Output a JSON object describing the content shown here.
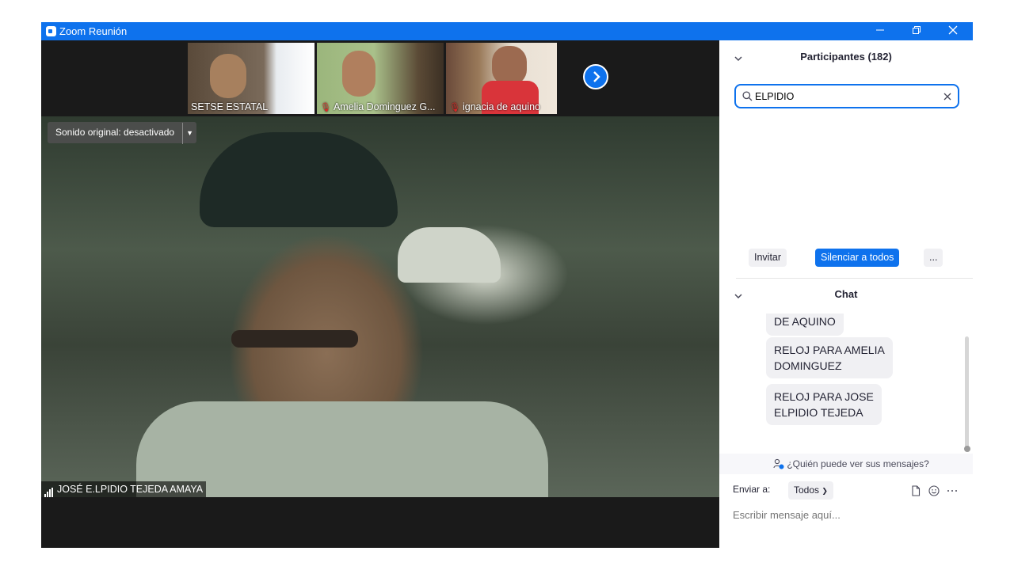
{
  "window": {
    "title": "Zoom Reunión"
  },
  "thumbnails": [
    {
      "name": "SETSE ESTATAL",
      "muted": false
    },
    {
      "name": "Amelia Dominguez G...",
      "muted": true
    },
    {
      "name": "ignacia de aquino",
      "muted": true
    }
  ],
  "main_video": {
    "sound_label": "Sonido original: desactivado",
    "speaker_name": "JOSÉ E.LPIDIO TEJEDA AMAYA"
  },
  "participants": {
    "title": "Participantes (182)",
    "search_value": "ELPIDIO",
    "invite_label": "Invitar",
    "mute_all_label": "Silenciar a todos",
    "more_label": "..."
  },
  "chat": {
    "title": "Chat",
    "messages": [
      {
        "line1": "DE AQUINO",
        "line2": ""
      },
      {
        "line1": "RELOJ PARA AMELIA",
        "line2": "DOMINGUEZ"
      },
      {
        "line1": "RELOJ PARA JOSE",
        "line2": "ELPIDIO TEJEDA"
      }
    ],
    "who_can_see": "¿Quién puede ver sus mensajes?",
    "send_to_label": "Enviar a:",
    "send_to_value": "Todos",
    "input_placeholder": "Escribir mensaje aquí..."
  },
  "colors": {
    "accent": "#0e72ed",
    "muted_mic": "#e02828"
  }
}
